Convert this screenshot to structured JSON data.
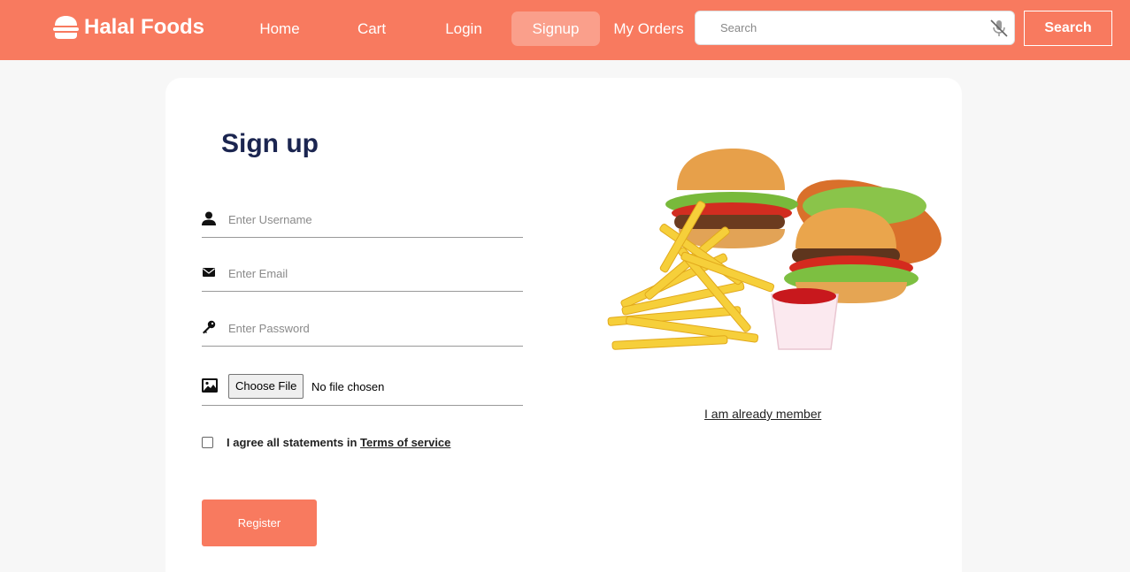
{
  "brand": {
    "name": "Halal Foods",
    "icon": "burger-icon"
  },
  "nav": {
    "items": [
      {
        "label": "Home"
      },
      {
        "label": "Cart"
      },
      {
        "label": "Login"
      },
      {
        "label": "Signup",
        "active": true
      },
      {
        "label": "My Orders"
      }
    ]
  },
  "search": {
    "placeholder": "Search",
    "button_label": "Search",
    "voice_icon": "microphone-muted-icon"
  },
  "form": {
    "title": "Sign up",
    "username_placeholder": "Enter Username",
    "email_placeholder": "Enter Email",
    "password_placeholder": "Enter Password",
    "file_button": "Choose File",
    "file_status": "No file chosen",
    "agree_text": "I agree all statements in ",
    "tos_label": "Terms of service",
    "register_label": "Register"
  },
  "side": {
    "member_link": "I am already member"
  },
  "colors": {
    "accent": "#f87a5f",
    "title": "#1b2550"
  }
}
